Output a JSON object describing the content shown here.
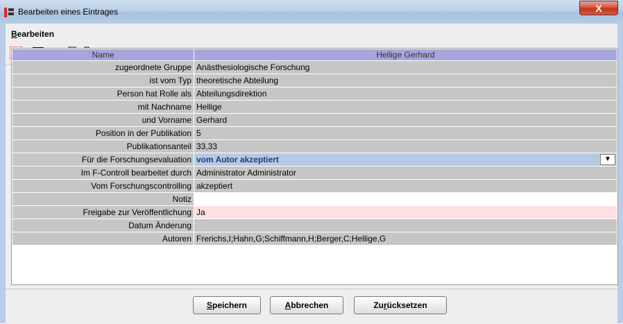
{
  "window": {
    "title": "Bearbeiten eines Eintrages",
    "close_glyph": "X"
  },
  "menu": {
    "items": [
      {
        "label_accel": "B",
        "label_rest": "earbeiten"
      }
    ]
  },
  "toolbar": {
    "icons": [
      "exit-icon",
      "save-icon",
      "cut-icon",
      "copy-icon",
      "paste-icon"
    ]
  },
  "table": {
    "headers": [
      "Name",
      "Hellige Gerhard"
    ],
    "rows": [
      {
        "key": "zugeordnete Gruppe",
        "value": "Anästhesiologische Forschung"
      },
      {
        "key": "ist vom Typ",
        "value": "theoretische Abteilung"
      },
      {
        "key": "Person hat Rolle als",
        "value": "Abteilungsdirektion"
      },
      {
        "key": "mit Nachname",
        "value": "Hellige"
      },
      {
        "key": "und Vorname",
        "value": "Gerhard"
      },
      {
        "key": "Position in der Publikation",
        "value": "5"
      },
      {
        "key": "Publikationsanteil",
        "value": "33,33"
      },
      {
        "key": "Für die Forschungsevaluation",
        "value": "vom Autor akzeptiert"
      },
      {
        "key": "Im F-Controll bearbeitet durch",
        "value": "Administrator Administrator"
      },
      {
        "key": "Vom Forschungscontrolling",
        "value": "akzeptiert"
      },
      {
        "key": "Notiz",
        "value": ""
      },
      {
        "key": "Freigabe zur Veröffentlichung",
        "value": "Ja"
      },
      {
        "key": "Datum Änderung",
        "value": ""
      },
      {
        "key": "Autoren",
        "value": "Frerichs,I;Hahn,G;Schiffmann,H;Berger,C;Hellige,G"
      }
    ]
  },
  "buttons": {
    "save": {
      "accel": "S",
      "rest": "peichern"
    },
    "cancel": {
      "accel": "A",
      "rest": "bbrechen"
    },
    "reset": {
      "pre": "Zu",
      "accel": "r",
      "rest": "ücksetzen"
    }
  },
  "colors": {
    "header_bg": "#a6a6dc",
    "row_bg": "#c6c6c6",
    "selected_bg": "#b8c8e4",
    "pink_bg": "#fde0e0",
    "close_red": "#c2351f"
  }
}
